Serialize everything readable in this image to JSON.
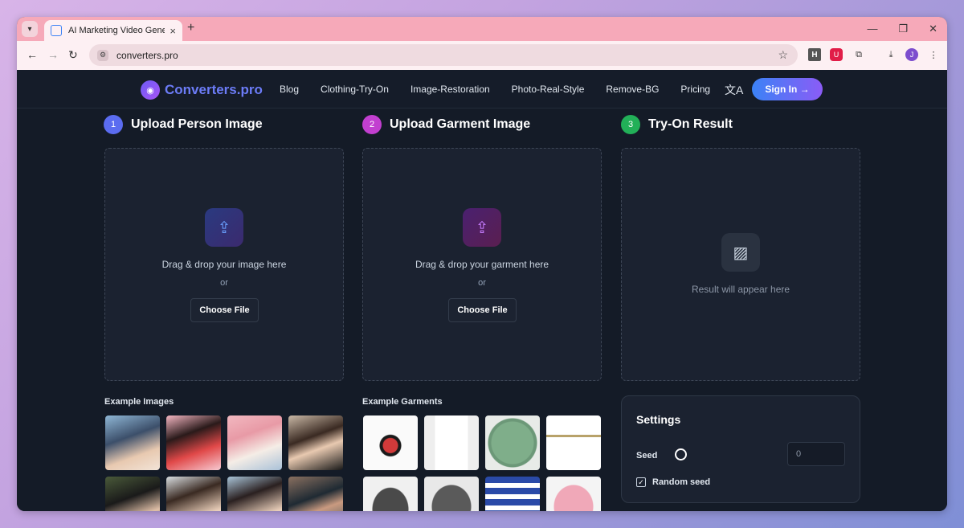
{
  "browser": {
    "tab_title": "AI Marketing Video Generator |",
    "url": "converters.pro",
    "avatar_initial": "J",
    "ext_h": "H"
  },
  "nav": {
    "logo": "Converters.pro",
    "links": [
      "Blog",
      "Clothing-Try-On",
      "Image-Restoration",
      "Photo-Real-Style",
      "Remove-BG",
      "Pricing"
    ],
    "signin": "Sign In →"
  },
  "sections": [
    {
      "step": "1",
      "title": "Upload Person Image",
      "drop_text": "Drag & drop your image here",
      "or": "or",
      "button": "Choose File",
      "color": "#5b6cf0"
    },
    {
      "step": "2",
      "title": "Upload Garment Image",
      "drop_text": "Drag & drop your garment here",
      "or": "or",
      "button": "Choose File",
      "color": "#c23fd0"
    },
    {
      "step": "3",
      "title": "Try-On Result",
      "result_text": "Result will appear here",
      "color": "#22b058"
    }
  ],
  "examples": {
    "images_label": "Example Images",
    "garments_label": "Example Garments"
  },
  "settings": {
    "title": "Settings",
    "seed_label": "Seed",
    "seed_value": "0",
    "random_seed_label": "Random seed",
    "random_seed_checked": true
  }
}
